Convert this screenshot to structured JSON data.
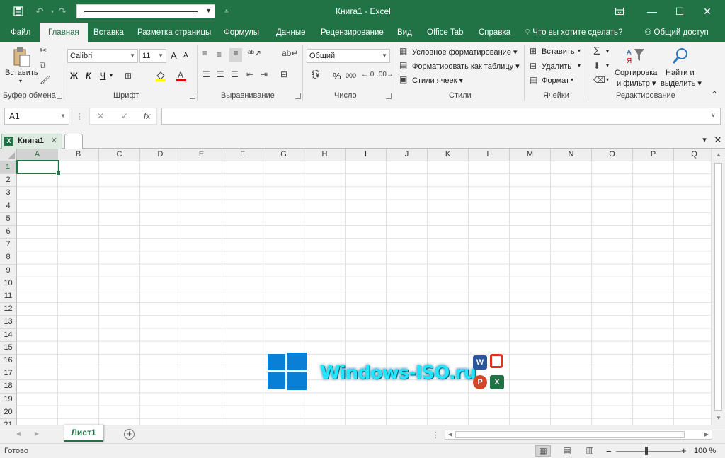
{
  "window": {
    "title": "Книга1  -  Excel",
    "minimize_icon": "minimize-icon",
    "maximize_icon": "maximize-icon",
    "close_icon": "close-icon",
    "ribbon_display_icon": "ribbon-display-options-icon"
  },
  "menu": {
    "tabs": [
      "Файл",
      "Главная",
      "Вставка",
      "Разметка страницы",
      "Формулы",
      "Данные",
      "Рецензирование",
      "Вид",
      "Office Tab",
      "Справка"
    ],
    "active_tab": "Главная",
    "tell_me": "Что вы хотите сделать?",
    "share": "Общий доступ"
  },
  "ribbon": {
    "clipboard": {
      "paste": "Вставить",
      "label": "Буфер обмена"
    },
    "font": {
      "name": "Calibri",
      "size": "11",
      "bold": "Ж",
      "italic": "К",
      "underline": "Ч",
      "grow": "A",
      "shrink": "A",
      "label": "Шрифт"
    },
    "alignment": {
      "label": "Выравнивание"
    },
    "number": {
      "format": "Общий",
      "percent": "%",
      "comma": "000",
      "label": "Число"
    },
    "styles": {
      "conditional": "Условное форматирование",
      "as_table": "Форматировать как таблицу",
      "cell_styles": "Стили ячеек",
      "label": "Стили"
    },
    "cells": {
      "insert": "Вставить",
      "delete": "Удалить",
      "format": "Формат",
      "label": "Ячейки"
    },
    "editing": {
      "sort_line1": "Сортировка",
      "sort_line2": "и фильтр",
      "find_line1": "Найти и",
      "find_line2": "выделить",
      "label": "Редактирование"
    }
  },
  "formula_bar": {
    "name_box": "A1",
    "cancel": "✕",
    "enter": "✓",
    "fx": "fx",
    "value": ""
  },
  "doc_tabs": {
    "workbook": "Книга1"
  },
  "grid": {
    "columns": [
      "A",
      "B",
      "C",
      "D",
      "E",
      "F",
      "G",
      "H",
      "I",
      "J",
      "K",
      "L",
      "M",
      "N",
      "O",
      "P",
      "Q"
    ],
    "rows": [
      "1",
      "2",
      "3",
      "4",
      "5",
      "6",
      "7",
      "8",
      "9",
      "10",
      "11",
      "12",
      "13",
      "14",
      "15",
      "16",
      "17",
      "18",
      "19",
      "20",
      "21"
    ],
    "selected_cell": "A1"
  },
  "watermark": {
    "text": "Windows-ISO.ru"
  },
  "sheets": {
    "tabs": [
      "Лист1"
    ],
    "active": "Лист1"
  },
  "status": {
    "ready": "Готово",
    "zoom": "100 %"
  }
}
